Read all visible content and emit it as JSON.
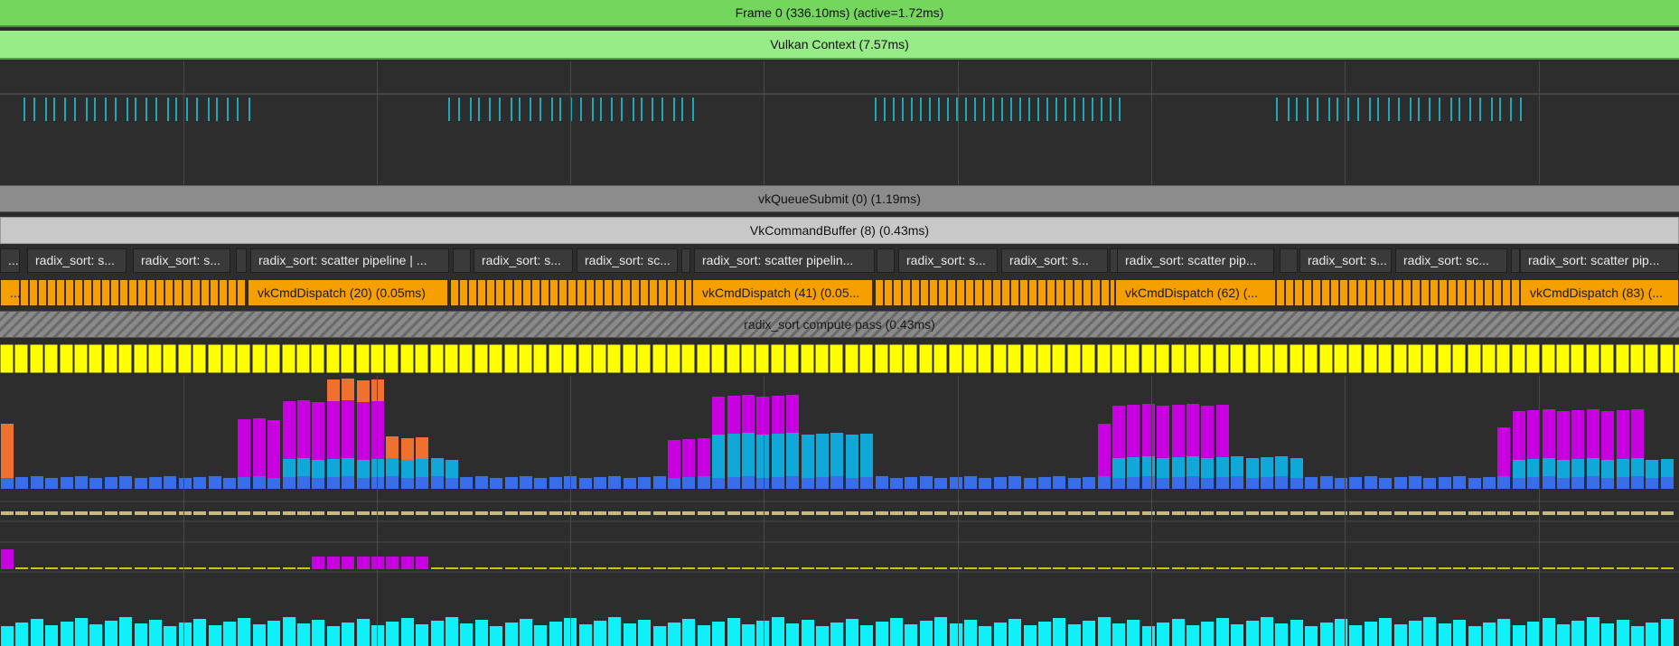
{
  "frame": {
    "label": "Frame 0 (336.10ms) (active=1.72ms)"
  },
  "context": {
    "label": "Vulkan Context (7.57ms)"
  },
  "queue_submit": {
    "label": "vkQueueSubmit (0) (1.19ms)"
  },
  "command_buffer": {
    "label": "VkCommandBuffer (8) (0.43ms)"
  },
  "compute_pass": {
    "label": "radix_sort compute pass (0.43ms)"
  },
  "zones": [
    {
      "text": "..."
    },
    {
      "text": "radix_sort: s..."
    },
    {
      "text": "radix_sort: s..."
    },
    {
      "text": ""
    },
    {
      "text": "radix_sort: scatter pipeline | ..."
    },
    {
      "text": ""
    },
    {
      "text": "radix_sort: s..."
    },
    {
      "text": "radix_sort: sc..."
    },
    {
      "text": ""
    },
    {
      "text": "radix_sort: scatter pipelin..."
    },
    {
      "text": ""
    },
    {
      "text": "radix_sort: s..."
    },
    {
      "text": "radix_sort: s..."
    },
    {
      "text": ""
    },
    {
      "text": "radix_sort: scatter pip..."
    },
    {
      "text": ""
    },
    {
      "text": "radix_sort: s..."
    },
    {
      "text": "radix_sort: sc..."
    },
    {
      "text": ""
    },
    {
      "text": "radix_sort: scatter pip..."
    }
  ],
  "dispatches": [
    {
      "text": "..."
    },
    {
      "text": "vkCmdDispatch (20) (0.05ms)"
    },
    {
      "text": "vkCmdDispatch (41) (0.05..."
    },
    {
      "text": "vkCmdDispatch (62) (..."
    },
    {
      "text": "vkCmdDispatch (83) (..."
    }
  ],
  "colors": {
    "frame": "#74d65d",
    "context": "#98ec88",
    "teal_tick": "#1fa8b8",
    "dispatch": "#f5a000",
    "yellow": "#ffff00",
    "magenta": "#c800e0",
    "cyan": "#10a8d8",
    "blue": "#3a6ee8",
    "orange": "#f07030",
    "tan": "#c8b880",
    "aqua": "#10f0f8"
  }
}
